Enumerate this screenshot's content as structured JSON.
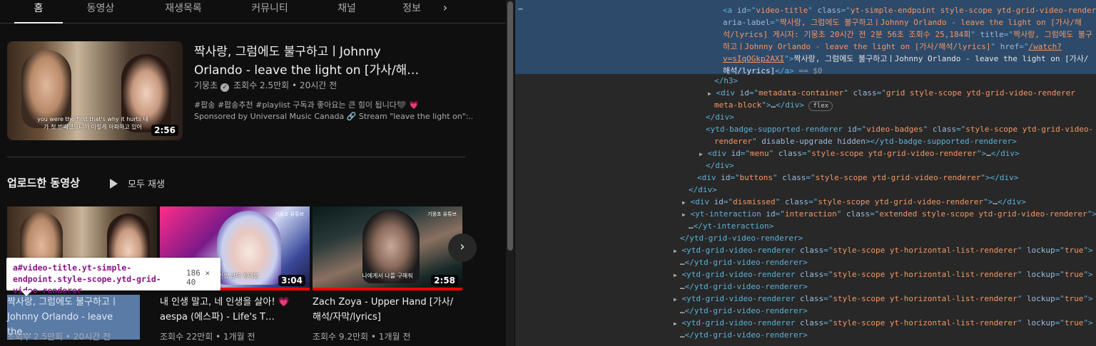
{
  "tabs": {
    "items": [
      "홈",
      "동영상",
      "재생목록",
      "커뮤니티",
      "채널",
      "정보"
    ],
    "next_icon": "chevron-right-icon"
  },
  "featured": {
    "title": "짝사랑, 그럼에도 불구하고ㅣJohnny Orlando - leave the light on [가사/해…",
    "channel": "기뭉초",
    "verified_icon": "check-icon",
    "meta": "조회수 2.5만회 • 20시간 전",
    "desc1": "#팝송 #팝송추천 #playlist 구독과 좋아요는 큰 힘이 됩니다🖤 💗",
    "desc2": "Sponsored by Universal Music Canada 🔗 Stream \"leave the light on\":...",
    "duration": "2:56",
    "subtitle": "you were the first that's why it hurts 네가 첫 번째였으니까 이렇게 아파하고 있어"
  },
  "section": {
    "title": "업로드한 동영상",
    "play_all": "모두 재생",
    "play_icon": "play-icon"
  },
  "cards": [
    {
      "title": "짝사랑, 그럼에도 불구하고ㅣJohnny Orlando - leave the…",
      "meta": "조회수 2.5만회 • 20시간 전",
      "duration": "",
      "watermark": "",
      "subtitle": ""
    },
    {
      "title": "내 인생 말고, 네 인생을 살아! 💗 aespa (에스파) - Life's T…",
      "meta": "조회수 22만회 • 1개월 전",
      "duration": "3:04",
      "watermark": "기뭉초 유튜브",
      "subtitle": "네 인생 살아 제대로"
    },
    {
      "title": "Zach Zoya - Upper Hand [가사/해석/자막/lyrics]",
      "meta": "조회수 9.2만회 • 1개월 전",
      "duration": "2:58",
      "watermark": "기뭉초 유튜브",
      "subtitle": "나에게서 나를 구해줘"
    }
  ],
  "carousel": {
    "next_icon": "chevron-right-icon"
  },
  "tooltip": {
    "selector": "a#video-title.yt-simple-endpoint.style-scope.ytd-grid-video-renderer",
    "size": "186 × 40"
  },
  "devtools": {
    "dots": "⋯",
    "selected_tag": "a",
    "selected_id": "video-title",
    "selected_class": "yt-simple-endpoint style-scope ytd-grid-video-renderer",
    "aria_label": "짝사랑, 그럼에도 불구하고ㅣJohnny Orlando - leave the light on [가사/해석/lyrics] 게시자: 기뭉초 20시간 전 2분 56초 조회수 25,184회",
    "title_attr": "짝사랑, 그럼에도 불구하고ㅣJohnny Orlando - leave the light on [가사/해석/lyrics]",
    "href": "/watch?v=sIqOGkp2AXI",
    "text": "짝사랑, 그럼에도 불구하고ㅣJohnny Orlando - leave the light on [가사/해석/lyrics]",
    "eq": "== $0",
    "flex_badge": "flex"
  }
}
